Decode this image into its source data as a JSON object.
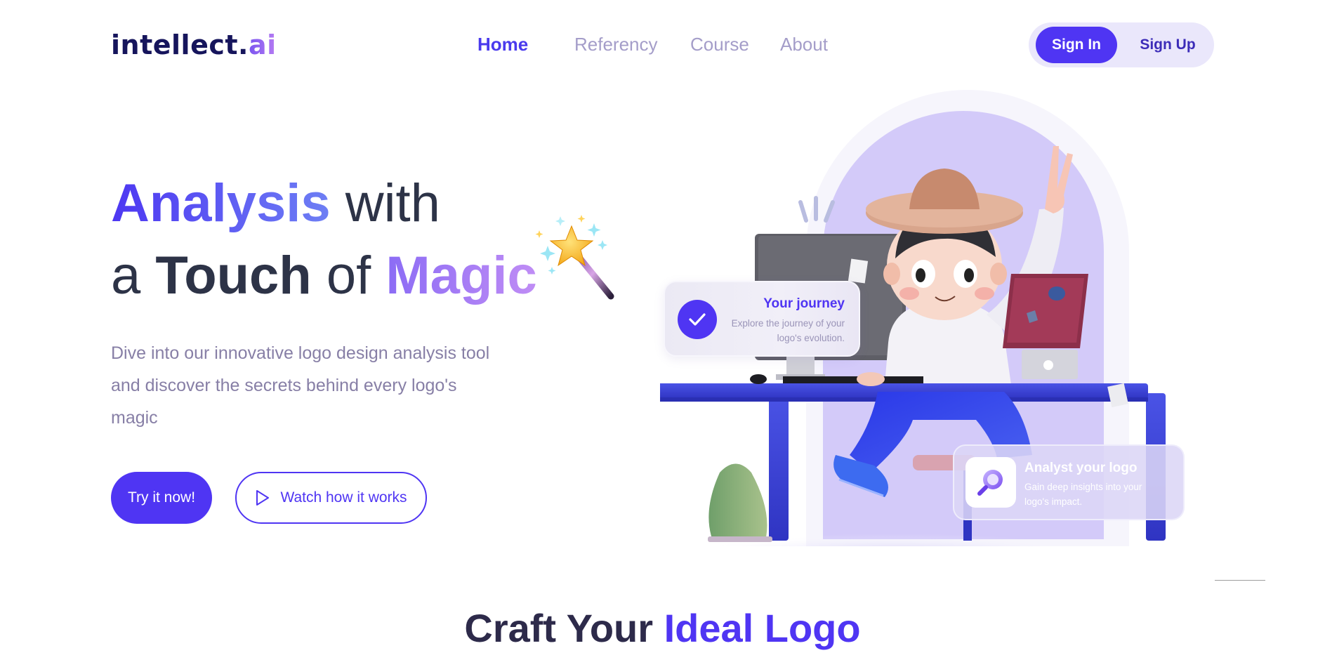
{
  "brand": {
    "name": "intellect",
    "dot": ".",
    "suffix": "ai"
  },
  "nav": {
    "items": [
      {
        "label": "Home",
        "active": true
      },
      {
        "label": "Referency",
        "active": false
      },
      {
        "label": "Course",
        "active": false
      },
      {
        "label": "About",
        "active": false
      }
    ]
  },
  "auth": {
    "sign_in": "Sign In",
    "sign_up": "Sign Up"
  },
  "hero": {
    "line1_highlight": "Analysis",
    "line1_rest": "with",
    "line2_a": "a",
    "line2_touch": "Touch",
    "line2_of": "of",
    "line2_magic": "Magic",
    "description": "Dive into our innovative logo design analysis tool and discover the secrets behind every logo's magic",
    "cta_primary": "Try it now!",
    "cta_secondary": "Watch how it works",
    "wand_icon": "magic-wand-icon"
  },
  "cards": {
    "journey": {
      "title": "Your journey",
      "subtitle": "Explore the journey of your logo's evolution."
    },
    "analyst": {
      "title": "Analyst your logo",
      "subtitle": "Gain deep insights into your logo's impact."
    }
  },
  "section": {
    "title_a": "Craft Your",
    "title_b": "Ideal Logo"
  },
  "colors": {
    "primary": "#4f35f3",
    "arch": "#d3caf9",
    "desk": "#3a3fd4",
    "text_dark": "#2d3347",
    "muted": "#877fa6"
  }
}
